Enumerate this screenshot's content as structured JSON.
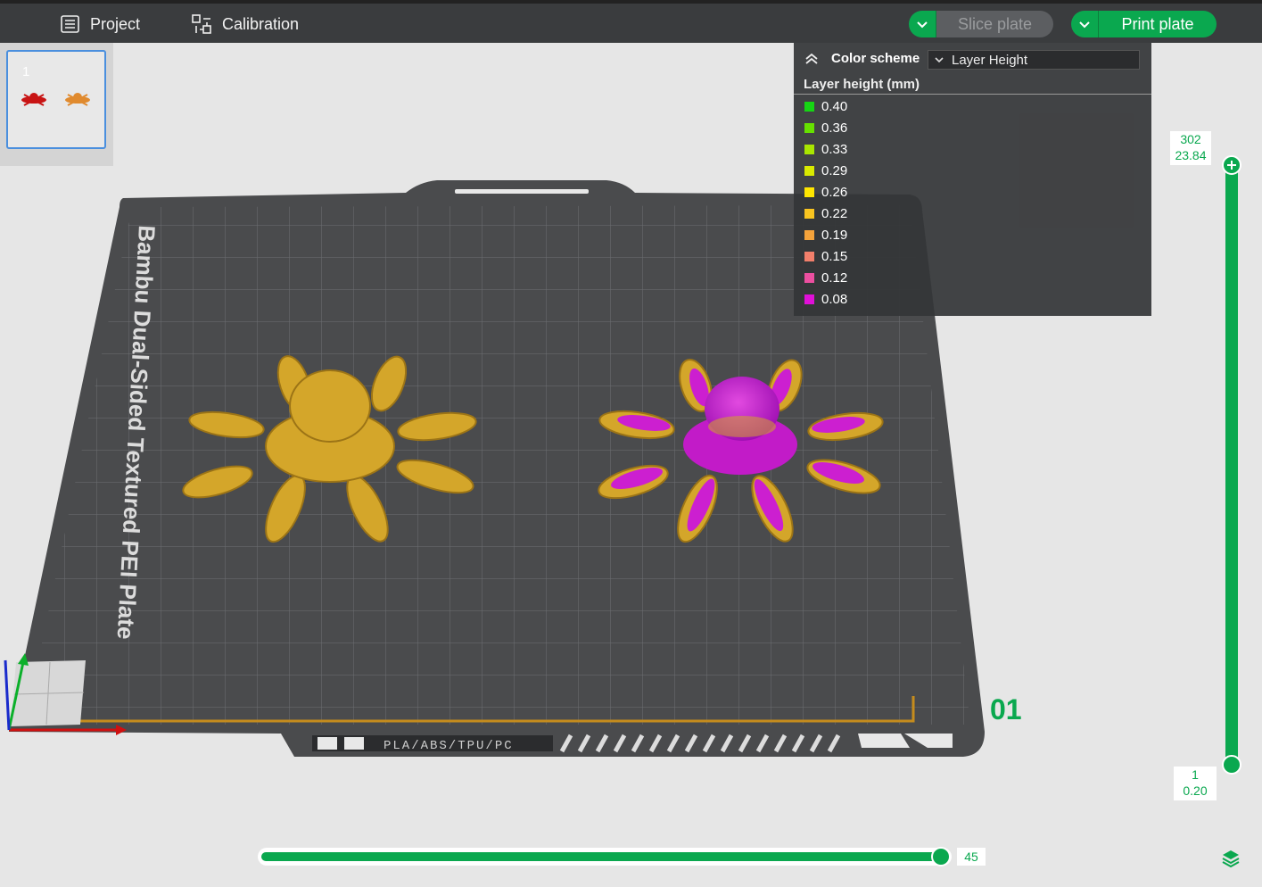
{
  "toolbar": {
    "project_label": "Project",
    "calibration_label": "Calibration",
    "slice_label": "Slice plate",
    "print_label": "Print plate"
  },
  "plates": [
    {
      "number": "1"
    }
  ],
  "bed": {
    "side_label": "Bambu Dual-Sided Textured PEI Plate",
    "bottom_label": "PLA/ABS/TPU/PC",
    "plate_number": "01"
  },
  "legend": {
    "color_scheme_label": "Color scheme",
    "selected_scheme": "Layer Height",
    "subtitle": "Layer height (mm)",
    "items": [
      {
        "value": "0.40",
        "color": "#16d613"
      },
      {
        "value": "0.36",
        "color": "#66e000"
      },
      {
        "value": "0.33",
        "color": "#a9e600"
      },
      {
        "value": "0.29",
        "color": "#d9ea00"
      },
      {
        "value": "0.26",
        "color": "#ffe600"
      },
      {
        "value": "0.22",
        "color": "#f8c420"
      },
      {
        "value": "0.19",
        "color": "#f5a33b"
      },
      {
        "value": "0.15",
        "color": "#f27f6b"
      },
      {
        "value": "0.12",
        "color": "#ec4fa0"
      },
      {
        "value": "0.08",
        "color": "#e010d8"
      }
    ]
  },
  "layer_slider": {
    "top_layer": "302",
    "top_height": "23.84",
    "bottom_layer": "1",
    "bottom_height": "0.20"
  },
  "move_slider": {
    "value": "45"
  },
  "colors": {
    "accent": "#0aa84f",
    "object_gold": "#d4a62a",
    "object_magenta": "#cc1fd0"
  }
}
